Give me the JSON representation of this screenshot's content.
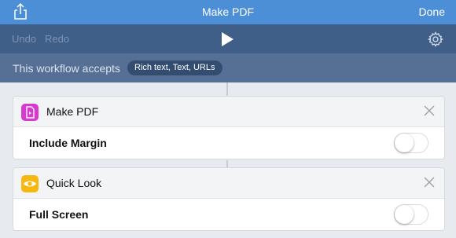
{
  "nav": {
    "share_icon": "share-icon",
    "title": "Make PDF",
    "done_label": "Done"
  },
  "toolbar": {
    "undo_label": "Undo",
    "redo_label": "Redo",
    "play_icon": "play-icon",
    "settings_icon": "gear-icon"
  },
  "accepts": {
    "label": "This workflow accepts",
    "types": "Rich text, Text, URLs"
  },
  "actions": [
    {
      "name": "Make PDF",
      "icon": "pdf-document-icon",
      "icon_color": "#d83ad0",
      "option_label": "Include Margin",
      "option_on": false
    },
    {
      "name": "Quick Look",
      "icon": "eye-icon",
      "icon_color": "#f6b80f",
      "option_label": "Full Screen",
      "option_on": false
    }
  ],
  "colors": {
    "nav_bar": "#4d8fd7",
    "toolbar": "#3f5f89",
    "accepts_bar": "#556f95",
    "chip": "#334d70",
    "background": "#e7eaee"
  }
}
